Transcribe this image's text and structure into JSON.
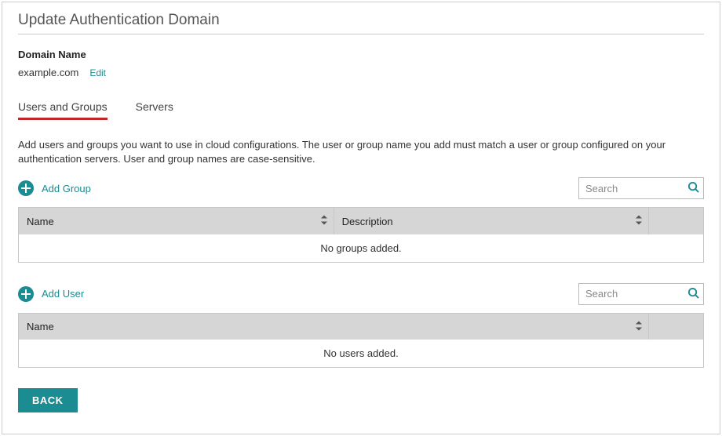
{
  "page_title": "Update Authentication Domain",
  "domain": {
    "label": "Domain Name",
    "value": "example.com",
    "edit_label": "Edit"
  },
  "tabs": [
    {
      "label": "Users and Groups",
      "active": true
    },
    {
      "label": "Servers",
      "active": false
    }
  ],
  "help_text": "Add users and groups you want to use in cloud configurations. The user or group name you add must match a user or group configured on your authentication servers. User and group names are case-sensitive.",
  "groups": {
    "add_label": "Add Group",
    "search_placeholder": "Search",
    "columns": {
      "name": "Name",
      "description": "Description"
    },
    "empty_text": "No groups added."
  },
  "users": {
    "add_label": "Add User",
    "search_placeholder": "Search",
    "columns": {
      "name": "Name"
    },
    "empty_text": "No users added."
  },
  "back_label": "BACK"
}
